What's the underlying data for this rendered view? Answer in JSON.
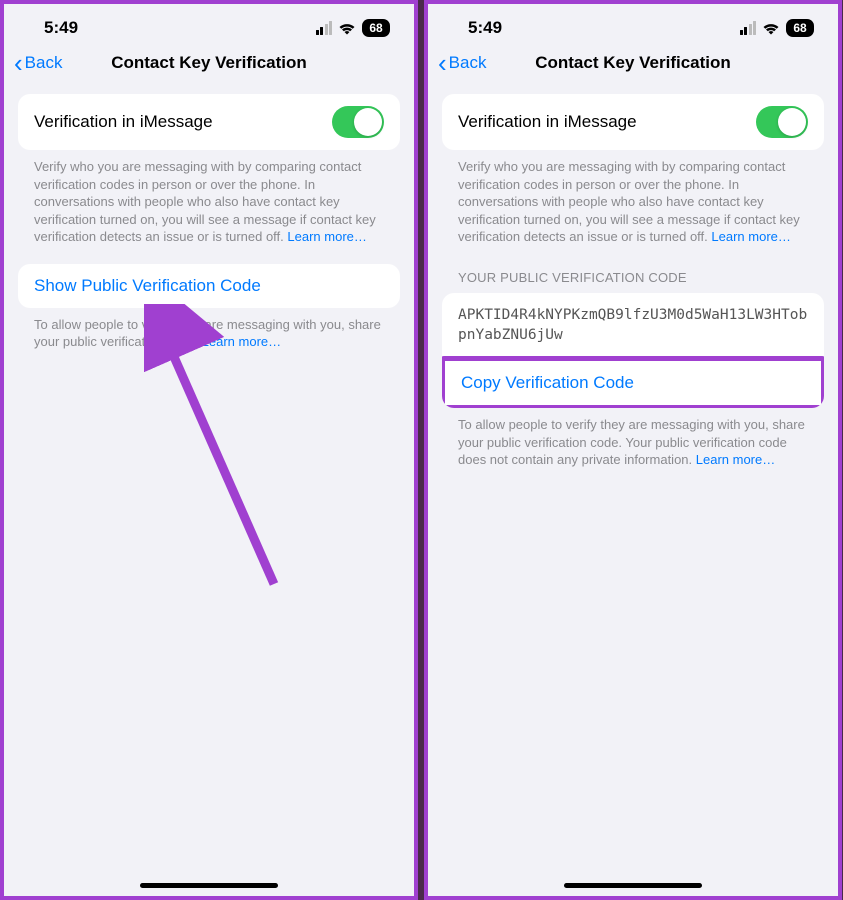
{
  "statusBar": {
    "time": "5:49",
    "battery": "68"
  },
  "nav": {
    "back": "Back",
    "title": "Contact Key Verification"
  },
  "toggle": {
    "label": "Verification in iMessage"
  },
  "descriptions": {
    "verify": "Verify who you are messaging with by comparing contact verification codes in person or over the phone. In conversations with people who also have contact key verification turned on, you will see a message if contact key verification detects an issue or is turned off. ",
    "learnMore": "Learn more…",
    "shareLeft": "To allow people to verify they are messaging with you, share your public verification code. ",
    "shareRight": "To allow people to verify they are messaging with you, share your public verification code. Your public verification code does not contain any private information. "
  },
  "actions": {
    "showCode": "Show Public Verification Code",
    "copyCode": "Copy Verification Code"
  },
  "codeSection": {
    "header": "YOUR PUBLIC VERIFICATION CODE",
    "code": "APKTID4R4kNYPKzmQB9lfzU3M0d5WaH13LW3HTobpnYabZNU6jUw"
  }
}
